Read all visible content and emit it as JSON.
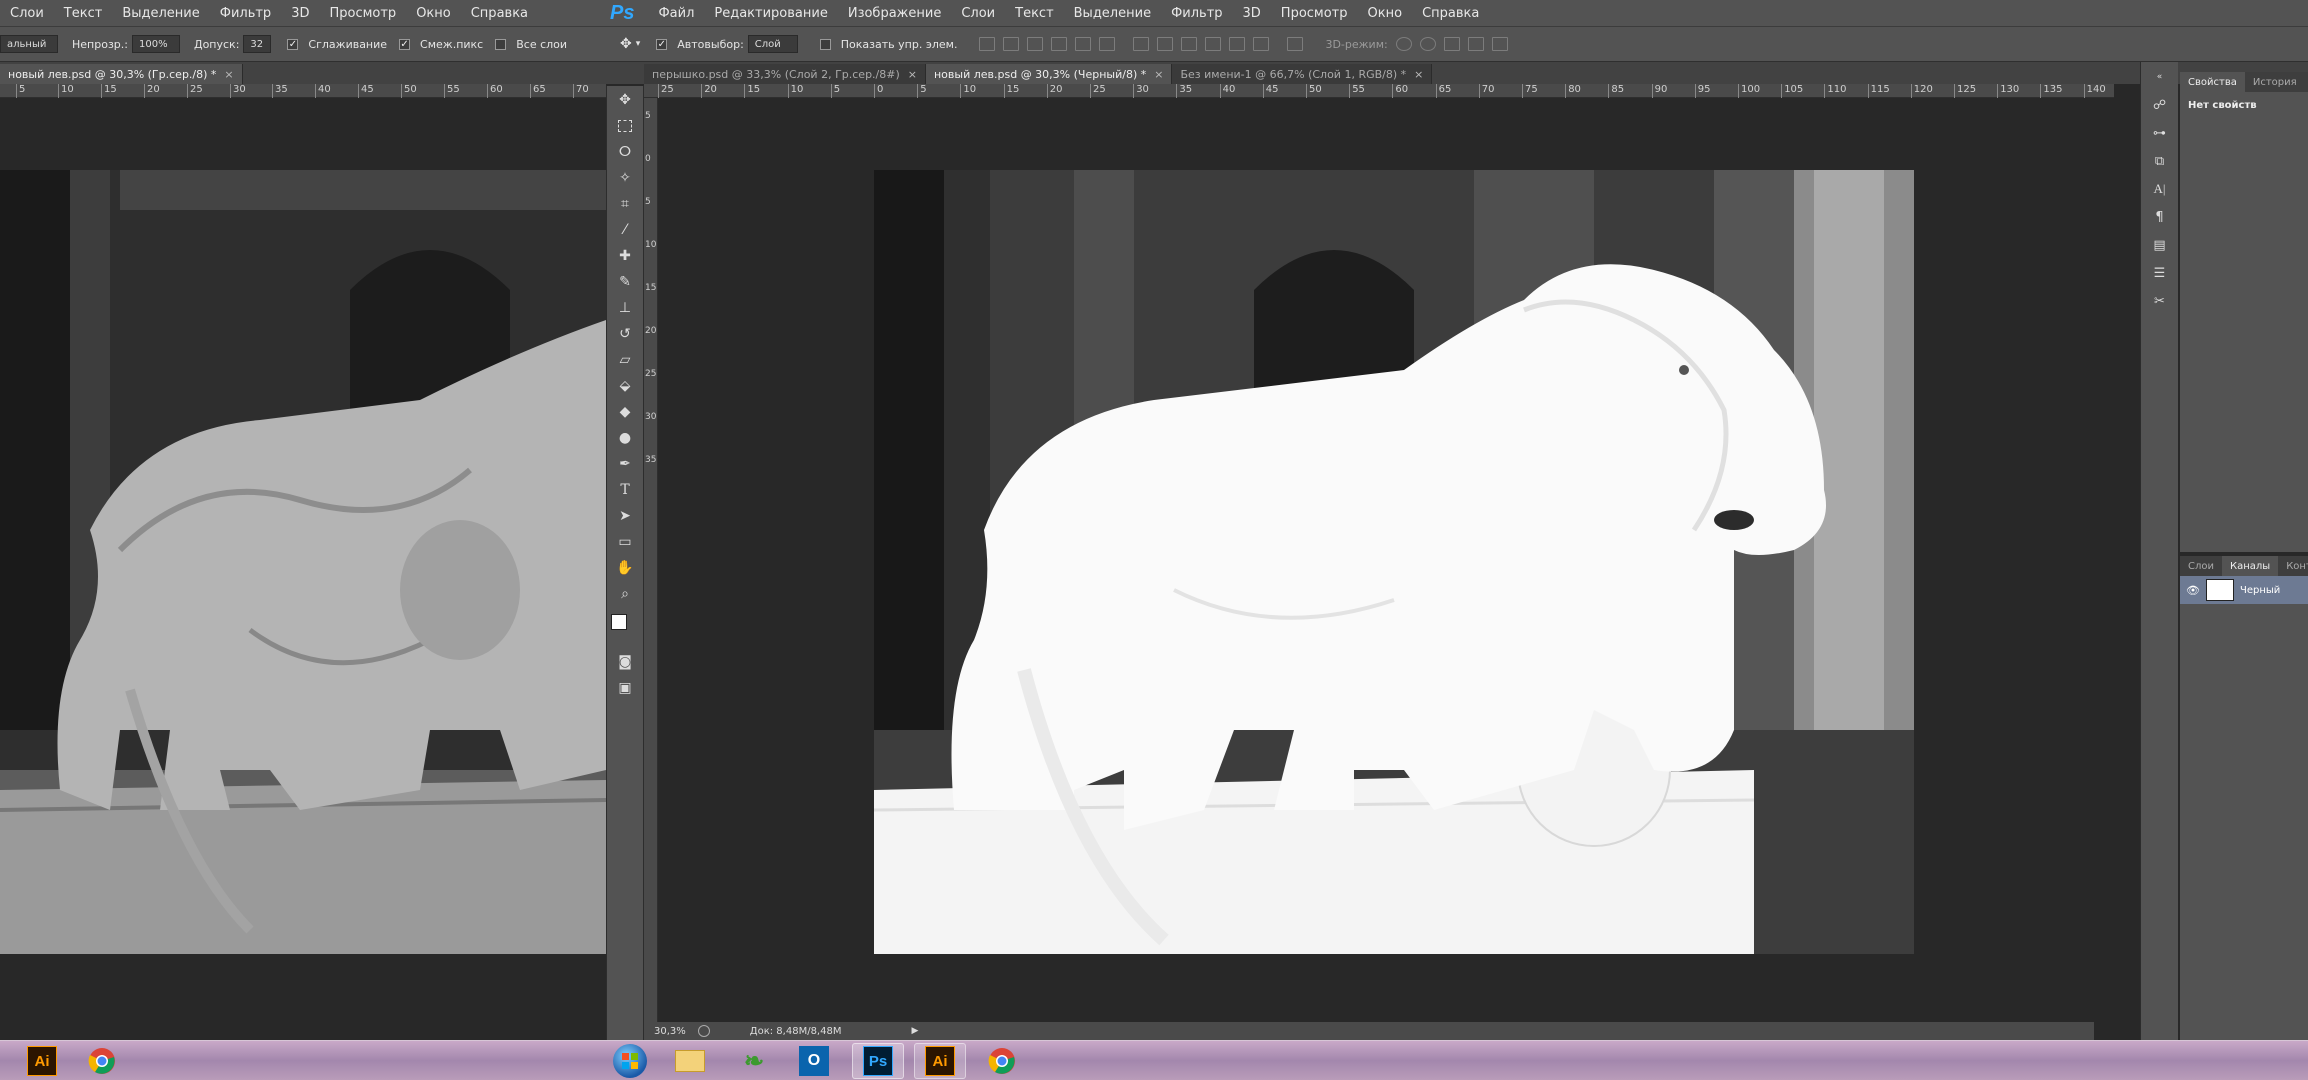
{
  "left_window": {
    "menu": [
      "Слои",
      "Текст",
      "Выделение",
      "Фильтр",
      "3D",
      "Просмотр",
      "Окно",
      "Справка"
    ],
    "options": {
      "mode_value": "альный",
      "opacity_label": "Непрозр.:",
      "opacity_value": "100%",
      "tolerance_label": "Допуск:",
      "tolerance_value": "32",
      "antialias_label": "Сглаживание",
      "contiguous_label": "Смеж.пикс",
      "all_layers_label": "Все слои"
    },
    "tab_title": "новый лев.psd @ 30,3% (Гр.сер./8) *",
    "ruler": [
      "5",
      "10",
      "15",
      "20",
      "25",
      "30",
      "35",
      "40",
      "45",
      "50",
      "55",
      "60",
      "65",
      "70"
    ]
  },
  "right_window": {
    "logo": "Ps",
    "menu": [
      "Файл",
      "Редактирование",
      "Изображение",
      "Слои",
      "Текст",
      "Выделение",
      "Фильтр",
      "3D",
      "Просмотр",
      "Окно",
      "Справка"
    ],
    "options": {
      "autoselect_label": "Автовыбор:",
      "autoselect_value": "Слой",
      "show_controls_label": "Показать упр. элем.",
      "mode3d_label": "3D-режим:"
    },
    "tabs": [
      {
        "label": "перышко.psd @ 33,3% (Слой 2, Гр.сер./8#)",
        "close": "×"
      },
      {
        "label": "новый лев.psd @ 30,3% (Черный/8) *",
        "close": "×"
      },
      {
        "label": "Без имени-1 @ 66,7% (Слой 1, RGB/8) *",
        "close": "×"
      }
    ],
    "ruler_h": [
      "25",
      "20",
      "15",
      "10",
      "5",
      "0",
      "5",
      "10",
      "15",
      "20",
      "25",
      "30",
      "35",
      "40",
      "45",
      "50",
      "55",
      "60",
      "65",
      "70",
      "75",
      "80",
      "85",
      "90",
      "95",
      "100",
      "105",
      "110",
      "115",
      "120",
      "125",
      "130",
      "135",
      "140"
    ],
    "ruler_v": [
      "5",
      "0",
      "5",
      "10",
      "15",
      "20",
      "25",
      "30",
      "35"
    ],
    "status": {
      "zoom": "30,3%",
      "doc": "Док: 8,48M/8,48M"
    }
  },
  "panels": {
    "properties_tabs": [
      "Свойства",
      "История"
    ],
    "properties_empty": "Нет свойств",
    "channel_tabs": [
      "Слои",
      "Каналы",
      "Конту"
    ],
    "channel_name": "Черный"
  },
  "taskbar": {
    "left_apps": [
      "Ai",
      "chrome"
    ],
    "right_apps": [
      "start",
      "explorer",
      "green-app",
      "Outlook",
      "Ps",
      "Ai",
      "chrome"
    ],
    "ai_label": "Ai",
    "ps_label": "Ps",
    "outlook_label": "O"
  },
  "colors": {
    "ui_bg": "#535353",
    "canvas_bg": "#282828",
    "ps_blue": "#31a8ff",
    "ai_orange": "#ff9a00"
  }
}
